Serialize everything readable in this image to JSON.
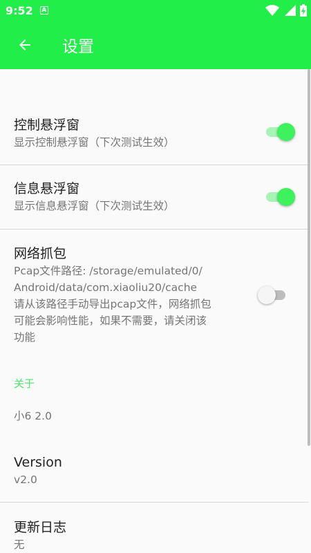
{
  "status_bar": {
    "time": "9:52",
    "notification_letter": "A",
    "wifi_icon": "wifi-icon",
    "signal_icon": "signal-icon",
    "battery_icon": "battery-charging-icon"
  },
  "app_bar": {
    "back_icon": "arrow-back-icon",
    "title": "设置"
  },
  "preferences": [
    {
      "title": "控制悬浮窗",
      "summary": "显示控制悬浮窗（下次测试生效）",
      "switch_on": true
    },
    {
      "title": "信息悬浮窗",
      "summary": "显示信息悬浮窗（下次测试生效）",
      "switch_on": true
    },
    {
      "title": "网络抓包",
      "summary_lines": [
        "Pcap文件路径: /storage/emulated/0/",
        "Android/data/com.xiaoliu20/cache",
        "请从该路径手动导出pcap文件，网络抓包",
        "可能会影响性能，如果不需要，请关闭该",
        "功能"
      ],
      "switch_on": false
    }
  ],
  "about": {
    "category": "关于",
    "app_version_label": "小6 2.0",
    "version_title": "Version",
    "version_value": "v2.0",
    "changelog_title": "更新日志",
    "changelog_value": "无"
  },
  "colors": {
    "primary": "#22ee4a",
    "switch_thumb_on": "#3df25c",
    "switch_track_on": "#a6f5b5",
    "category_text": "#4fe36a"
  }
}
